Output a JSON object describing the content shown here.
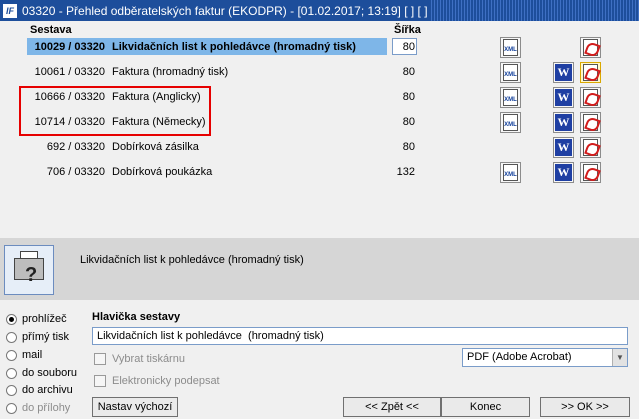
{
  "window": {
    "title": "03320 - Přehled odběratelských faktur (EKODPR) - [01.02.2017; 13:19]  [ ]  [ ]",
    "app_icon": "IF"
  },
  "table": {
    "col_sestava": "Sestava",
    "col_sirka": "Šířka",
    "rows": [
      {
        "code": "10029 / 03320",
        "name": "Likvidačních list k pohledávce  (hromadný tisk)",
        "width": "80",
        "selected": true,
        "xml": true,
        "word": false,
        "pdf": true
      },
      {
        "code": "10061 / 03320",
        "name": "Faktura (hromadný tisk)",
        "width": "80",
        "xml": true,
        "word": true,
        "pdf": true
      },
      {
        "code": "10666 / 03320",
        "name": "Faktura (Anglicky)",
        "width": "80",
        "xml": true,
        "word": true,
        "pdf": true
      },
      {
        "code": "10714 / 03320",
        "name": "Faktura (Německy)",
        "width": "80",
        "xml": true,
        "word": true,
        "pdf": true
      },
      {
        "code": "692 / 03320",
        "name": "Dobírková zásilka",
        "width": "80",
        "xml": false,
        "word": true,
        "pdf": true
      },
      {
        "code": "706 / 03320",
        "name": "Dobírková poukázka",
        "width": "132",
        "xml": true,
        "word": true,
        "pdf": true
      }
    ]
  },
  "icons": {
    "xml": "XML",
    "word": "W"
  },
  "info": {
    "description": "Likvidačních list k pohledávce  (hromadný tisk)"
  },
  "output": {
    "options": [
      {
        "label": "prohlížeč",
        "checked": true
      },
      {
        "label": "přímý tisk",
        "checked": false
      },
      {
        "label": "mail",
        "checked": false
      },
      {
        "label": "do souboru",
        "checked": false
      },
      {
        "label": "do archivu",
        "checked": false
      },
      {
        "label": "do přílohy",
        "checked": false,
        "disabled": true
      }
    ]
  },
  "form": {
    "header_label": "Hlavička sestavy",
    "header_value": "Likvidačních list k pohledávce  (hromadný tisk)",
    "choose_printer": "Vybrat tiskárnu",
    "e_sign": "Elektronicky podepsat",
    "printer_select": "PDF (Adobe Acrobat)"
  },
  "buttons": {
    "defaults": "Nastav výchozí",
    "back": "<< Zpět <<",
    "end": "Konec",
    "ok": ">> OK >>"
  },
  "colors": {
    "titlebar": "#1d4e9b",
    "selection": "#7eb6e8",
    "highlight_frame": "#e60000"
  }
}
